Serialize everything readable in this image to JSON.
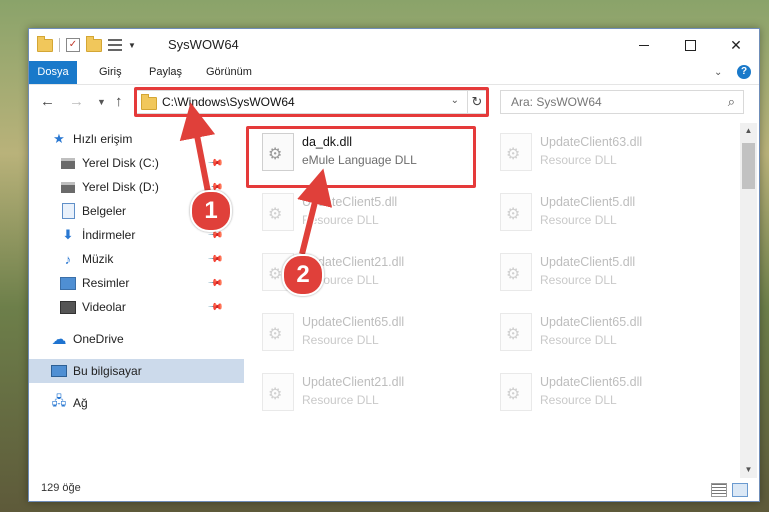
{
  "window": {
    "title": "SysWOW64"
  },
  "ribbon": {
    "tabs": [
      "Dosya",
      "Giriş",
      "Paylaş",
      "Görünüm"
    ],
    "help": "?"
  },
  "address": {
    "path": "C:\\Windows\\SysWOW64",
    "search_placeholder": "Ara: SysWOW64"
  },
  "sidebar": {
    "items": [
      {
        "label": "Hızlı erişim",
        "icon": "star-icon"
      },
      {
        "label": "Yerel Disk (C:)",
        "icon": "disk-icon",
        "pinned": true
      },
      {
        "label": "Yerel Disk (D:)",
        "icon": "disk-icon",
        "pinned": true
      },
      {
        "label": "Belgeler",
        "icon": "documents-icon",
        "pinned": true
      },
      {
        "label": "İndirmeler",
        "icon": "download-icon",
        "pinned": true
      },
      {
        "label": "Müzik",
        "icon": "music-icon",
        "pinned": true
      },
      {
        "label": "Resimler",
        "icon": "pictures-icon",
        "pinned": true
      },
      {
        "label": "Videolar",
        "icon": "videos-icon",
        "pinned": true
      },
      {
        "label": "OneDrive",
        "icon": "cloud-icon"
      },
      {
        "label": "Bu bilgisayar",
        "icon": "computer-icon",
        "selected": true
      },
      {
        "label": "Ağ",
        "icon": "network-icon"
      }
    ]
  },
  "files": {
    "left": [
      {
        "name": "da_dk.dll",
        "type": "eMule Language DLL",
        "faded": false
      },
      {
        "name": "UpdateClient5.dll",
        "type": "Resource DLL",
        "faded": true
      },
      {
        "name": "UpdateClient21.dll",
        "type": "Resource DLL",
        "faded": true
      },
      {
        "name": "UpdateClient65.dll",
        "type": "Resource DLL",
        "faded": true
      },
      {
        "name": "UpdateClient21.dll",
        "type": "Resource DLL",
        "faded": true
      }
    ],
    "right": [
      {
        "name": "UpdateClient63.dll",
        "type": "Resource DLL",
        "faded": true
      },
      {
        "name": "UpdateClient5.dll",
        "type": "Resource DLL",
        "faded": true
      },
      {
        "name": "UpdateClient5.dll",
        "type": "Resource DLL",
        "faded": true
      },
      {
        "name": "UpdateClient65.dll",
        "type": "Resource DLL",
        "faded": true
      },
      {
        "name": "UpdateClient65.dll",
        "type": "Resource DLL",
        "faded": true
      }
    ]
  },
  "status": {
    "count": "129 öğe"
  },
  "annotations": {
    "badge1": "1",
    "badge2": "2"
  },
  "colors": {
    "accent": "#1979ca",
    "highlight": "#e53a3a",
    "selected": "#ccdaeb"
  }
}
